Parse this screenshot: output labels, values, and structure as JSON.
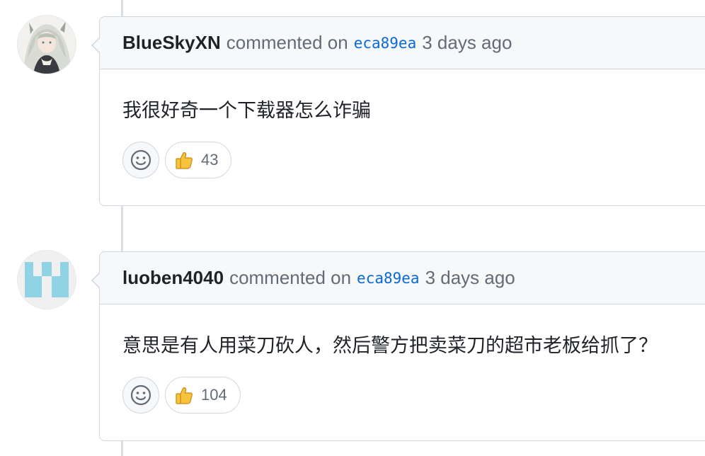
{
  "comments": [
    {
      "author": "BlueSkyXN",
      "verb": "commented on",
      "commit": "eca89ea",
      "time": "3 days ago",
      "body": "我很好奇一个下载器怎么诈骗",
      "reaction": {
        "icon": "thumbs-up-icon",
        "count": "43"
      }
    },
    {
      "author": "luoben4040",
      "verb": "commented on",
      "commit": "eca89ea",
      "time": "3 days ago",
      "body": "意思是有人用菜刀砍人，然后警方把卖菜刀的超市老板给抓了？",
      "reaction": {
        "icon": "thumbs-up-icon",
        "count": "104"
      }
    }
  ],
  "colors": {
    "border": "#d0d7de",
    "header_bg": "#f6f8fa",
    "link": "#0969da",
    "muted": "#636c76",
    "identicon": "#8fd3e4"
  }
}
